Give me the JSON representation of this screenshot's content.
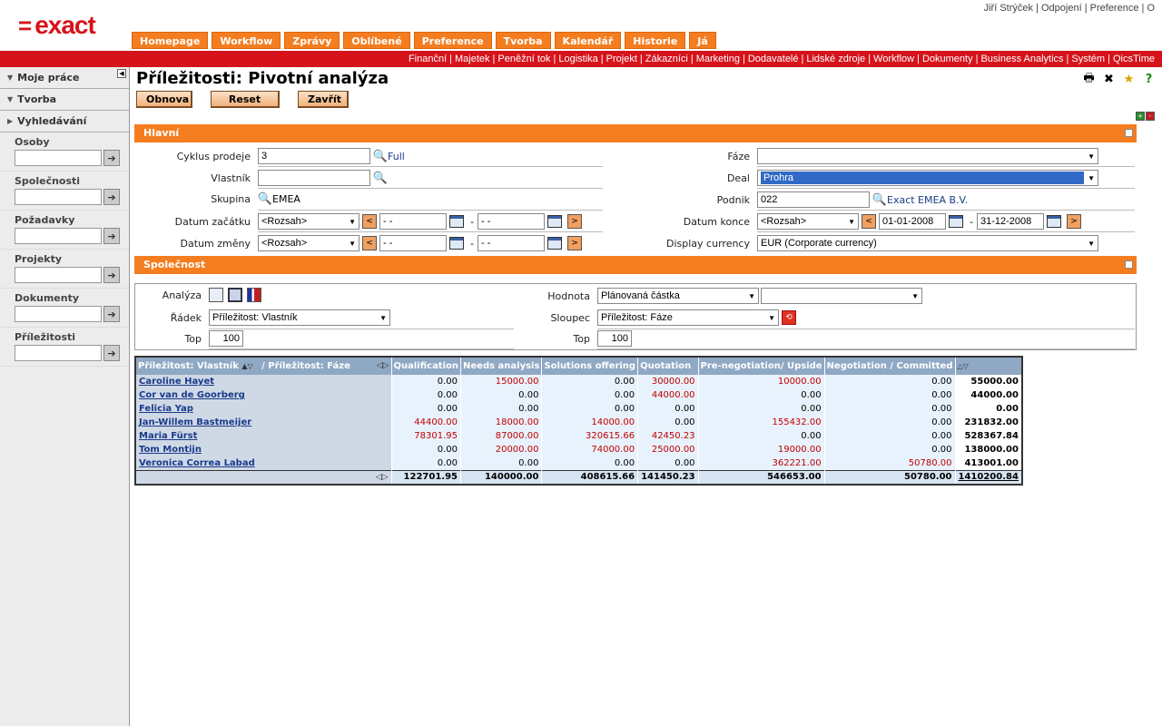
{
  "header": {
    "logo_mark": "=",
    "logo_text": "exact",
    "user_links": [
      "Jiří Strýček",
      "Odpojení",
      "Preference",
      "O"
    ],
    "main_tabs": [
      "Homepage",
      "Workflow",
      "Zprávy",
      "Oblíbené",
      "Preference",
      "Tvorba",
      "Kalendář",
      "Historie",
      "Já"
    ],
    "modules": [
      "Finanční",
      "Majetek",
      "Peněžní tok",
      "Logistika",
      "Projekt",
      "Zákazníci",
      "Marketing",
      "Dodavatelé",
      "Lidské zdroje",
      "Workflow",
      "Dokumenty",
      "Business Analytics",
      "Systém",
      "QicsTime"
    ]
  },
  "sidebar": {
    "heads": [
      "Moje práce",
      "Tvorba",
      "Vyhledávání"
    ],
    "sections": [
      "Osoby",
      "Společnosti",
      "Požadavky",
      "Projekty",
      "Dokumenty",
      "Příležitosti"
    ]
  },
  "page": {
    "title": "Příležitosti: Pivotní analýza",
    "buttons": {
      "refresh": "Obnova",
      "reset": "Reset",
      "close": "Zavřít"
    }
  },
  "main_section": {
    "title": "Hlavní",
    "cycle_label": "Cyklus prodeje",
    "cycle_value": "3",
    "cycle_link": "Full",
    "owner_label": "Vlastník",
    "owner_value": "",
    "group_label": "Skupina",
    "group_value": "EMEA",
    "start_label": "Datum začátku",
    "start_range": "<Rozsah>",
    "start_from": "- -",
    "start_to": "- -",
    "change_label": "Datum změny",
    "change_range": "<Rozsah>",
    "change_from": "- -",
    "change_to": "- -",
    "phase_label": "Fáze",
    "phase_value": "",
    "deal_label": "Deal",
    "deal_value": "Prohra",
    "company_label": "Podnik",
    "company_value": "022",
    "company_link": "Exact EMEA B.V.",
    "end_label": "Datum konce",
    "end_range": "<Rozsah>",
    "end_from": "01-01-2008",
    "end_to": "31-12-2008",
    "currency_label": "Display currency",
    "currency_value": "EUR (Corporate currency)"
  },
  "company_section": {
    "title": "Společnost"
  },
  "analysis": {
    "analysis_label": "Analýza",
    "row_label": "Řádek",
    "row_value": "Příležitost: Vlastník",
    "top_label": "Top",
    "top_value": "100",
    "value_label": "Hodnota",
    "value_value": "Plánovaná částka",
    "value_value2": "",
    "column_label": "Sloupec",
    "column_value": "Příležitost: Fáze",
    "top2_label": "Top",
    "top2_value": "100"
  },
  "pivot": {
    "corner_row": "Příležitost: Vlastník",
    "corner_col": "/ Příležitost: Fáze",
    "columns": [
      "Qualification",
      "Needs analysis",
      "Solutions offering",
      "Quotation",
      "Pre-negotiation/ Upside",
      "Negotiation / Committed"
    ],
    "rows": [
      {
        "name": "Caroline Hayet",
        "values": [
          "0.00",
          "15000.00",
          "0.00",
          "30000.00",
          "10000.00",
          "0.00"
        ],
        "total": "55000.00"
      },
      {
        "name": "Cor van de Goorberg",
        "values": [
          "0.00",
          "0.00",
          "0.00",
          "44000.00",
          "0.00",
          "0.00"
        ],
        "total": "44000.00"
      },
      {
        "name": "Felicia Yap",
        "values": [
          "0.00",
          "0.00",
          "0.00",
          "0.00",
          "0.00",
          "0.00"
        ],
        "total": "0.00"
      },
      {
        "name": "Jan-Willem Bastmeijer",
        "values": [
          "44400.00",
          "18000.00",
          "14000.00",
          "0.00",
          "155432.00",
          "0.00"
        ],
        "total": "231832.00"
      },
      {
        "name": "Maria Fürst",
        "values": [
          "78301.95",
          "87000.00",
          "320615.66",
          "42450.23",
          "0.00",
          "0.00"
        ],
        "total": "528367.84"
      },
      {
        "name": "Tom Montijn",
        "values": [
          "0.00",
          "20000.00",
          "74000.00",
          "25000.00",
          "19000.00",
          "0.00"
        ],
        "total": "138000.00"
      },
      {
        "name": "Veronica Correa Labad",
        "values": [
          "0.00",
          "0.00",
          "0.00",
          "0.00",
          "362221.00",
          "50780.00"
        ],
        "total": "413001.00"
      }
    ],
    "totals": [
      "122701.95",
      "140000.00",
      "408615.66",
      "141450.23",
      "546653.00",
      "50780.00"
    ],
    "grand_total": "1410200.84"
  }
}
